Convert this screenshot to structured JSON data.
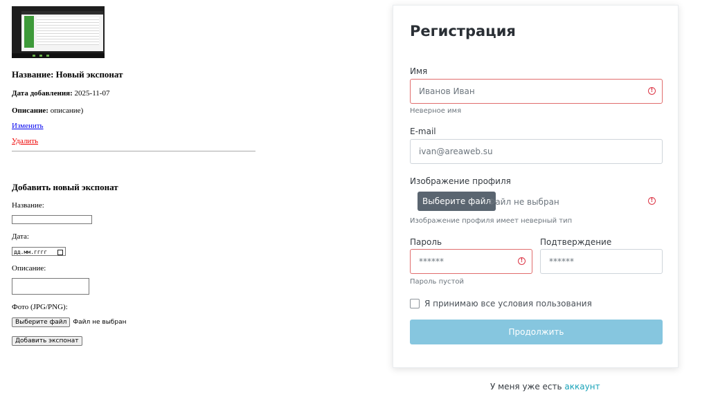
{
  "exhibit": {
    "title": "Название: Новый экспонат",
    "date_label": "Дата добавления:",
    "date_value": "2025-11-07",
    "desc_label": "Описание:",
    "desc_value": "описание)",
    "edit_link": "Изменить",
    "delete_link": "Удалить"
  },
  "add_form": {
    "heading": "Добавить новый экспонат",
    "name_label": "Название:",
    "date_label": "Дата:",
    "date_placeholder": "дд.мм.гггг",
    "desc_label": "Описание:",
    "photo_label": "Фото (JPG/PNG):",
    "file_button": "Выберите файл",
    "file_status": "Файл не выбран",
    "submit": "Добавить экспонат"
  },
  "register": {
    "title": "Регистрация",
    "name_label": "Имя",
    "name_value": "Иванов Иван",
    "name_error": "Неверное имя",
    "email_label": "E-mail",
    "email_value": "ivan@areaweb.su",
    "image_label": "Изображение профиля",
    "file_button": "Выберите файл",
    "file_status": "Файл не выбран",
    "image_error": "Изображение профиля имеет неверный тип",
    "password_label": "Пароль",
    "password_value": "******",
    "password_error": "Пароль пустой",
    "confirm_label": "Подтверждение",
    "confirm_value": "******",
    "terms_label": "Я принимаю все условия пользования",
    "continue_button": "Продолжить",
    "error_color": "#dc3545",
    "accent_color": "#86c6df"
  },
  "footer": {
    "text": "У меня уже есть",
    "link": "аккаунт"
  }
}
